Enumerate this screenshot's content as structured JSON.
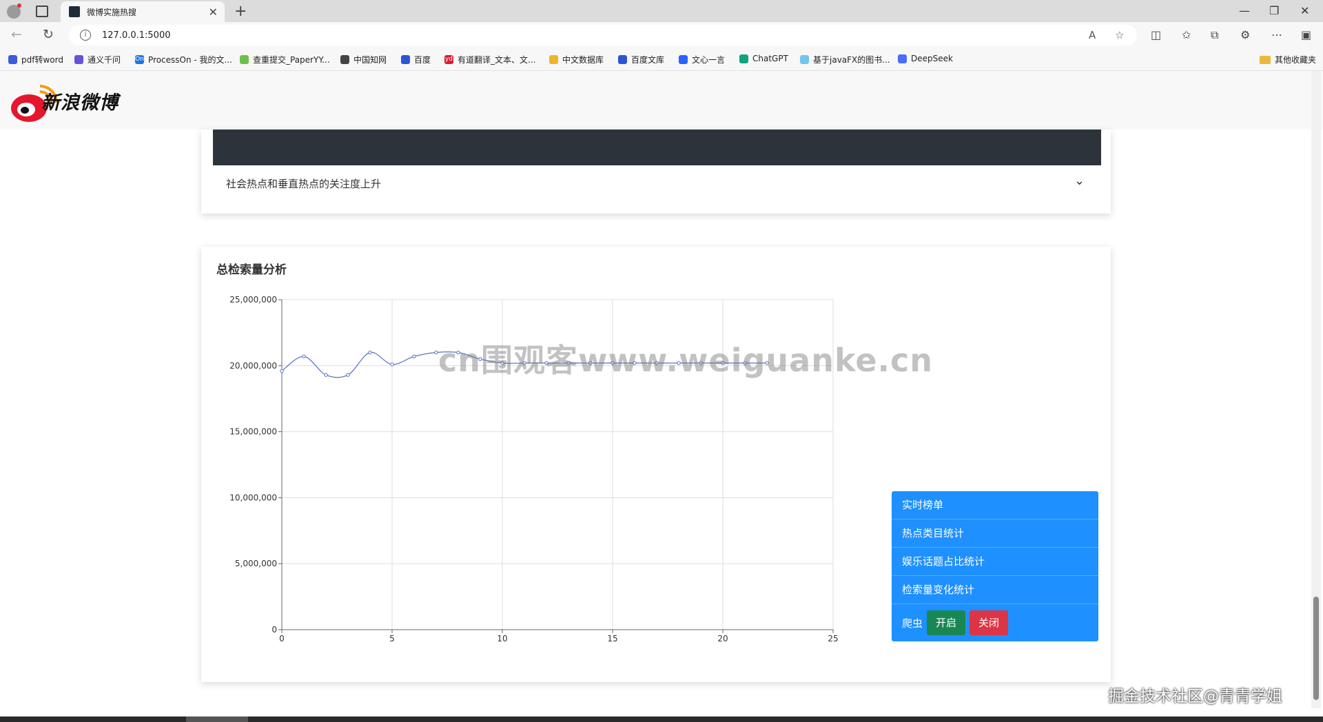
{
  "browser": {
    "tab_title": "微博实施热搜",
    "url": "127.0.0.1:5000",
    "bookmarks": [
      "pdf转word",
      "通义千问",
      "ProcessOn - 我的文...",
      "查重提交_PaperYY...",
      "中国知网",
      "百度",
      "有道翻译_文本、文...",
      "中文数据库",
      "百度文库",
      "文心一言",
      "ChatGPT",
      "基于javaFX的图书...",
      "DeepSeek"
    ],
    "bookmark_folder": "其他收藏夹"
  },
  "header": {
    "logo_text": "新浪微博"
  },
  "accordion": {
    "text": "社会热点和垂直热点的关注度上升"
  },
  "search_card": {
    "title": "总检索量分析"
  },
  "watermark": "cn围观客www.weiguanke.cn",
  "sidenav": {
    "items": [
      "实时榜单",
      "热点类目统计",
      "娱乐话题占比统计",
      "检索量变化统计"
    ],
    "crawler_label": "爬虫",
    "start_label": "开启",
    "stop_label": "关闭"
  },
  "credit": "掘金技术社区@青青学姐",
  "chart_data": {
    "type": "line",
    "title": "",
    "xlabel": "",
    "ylabel": "",
    "xlim": [
      0,
      25
    ],
    "ylim": [
      0,
      25000000
    ],
    "xticks": [
      0,
      5,
      10,
      15,
      20,
      25
    ],
    "yticks": [
      0,
      5000000,
      10000000,
      15000000,
      20000000,
      25000000
    ],
    "ytick_labels": [
      "0",
      "5,000,000",
      "10,000,000",
      "15,000,000",
      "20,000,000",
      "25,000,000"
    ],
    "grid": true,
    "series": [
      {
        "x": [
          0,
          1,
          2,
          3,
          4,
          5,
          6,
          7,
          8,
          9,
          10,
          11,
          12,
          13,
          14,
          15,
          16,
          17,
          18,
          19,
          20,
          21,
          22
        ],
        "y": [
          19600000,
          20700000,
          19300000,
          19300000,
          21000000,
          20100000,
          20700000,
          21000000,
          21000000,
          20500000,
          20200000,
          20200000,
          20200000,
          20200000,
          20200000,
          20200000,
          20200000,
          20200000,
          20200000,
          20200000,
          20200000,
          20200000,
          20200000
        ]
      }
    ]
  }
}
